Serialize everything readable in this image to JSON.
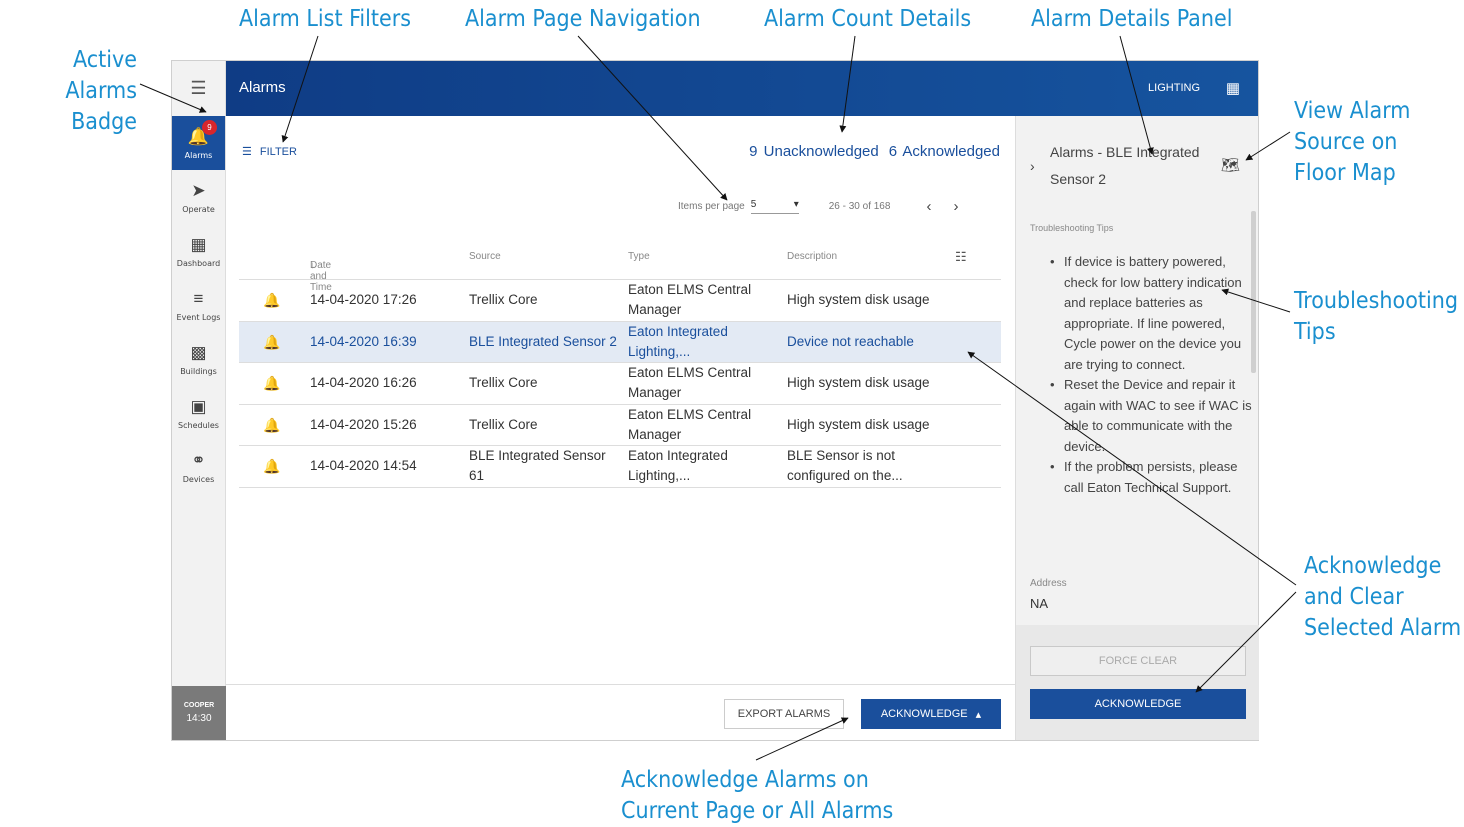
{
  "callouts": {
    "active_alarms_badge": [
      "Active Alarms",
      "Badge"
    ],
    "alarm_list_filters": "Alarm List Filters",
    "alarm_page_navigation": "Alarm Page Navigation",
    "alarm_count_details": "Alarm Count Details",
    "alarm_details_panel": "Alarm Details Panel",
    "view_alarm_source": [
      "View Alarm",
      "Source on",
      "Floor Map"
    ],
    "troubleshooting_tips": [
      "Troubleshooting",
      "Tips"
    ],
    "acknowledge_and_clear": [
      "Acknowledge",
      "and Clear",
      "Selected Alarm"
    ],
    "acknowledge_alarms_on": [
      "Acknowledge Alarms on",
      "Current Page or All Alarms"
    ]
  },
  "rail": {
    "menu_icon": "hamburger-icon",
    "items": [
      {
        "label": "Alarms",
        "icon": "bell-icon",
        "active": true,
        "badge": "9"
      },
      {
        "label": "Operate",
        "icon": "send-icon",
        "active": false
      },
      {
        "label": "Dashboard",
        "icon": "dashboard-icon",
        "active": false
      },
      {
        "label": "Event Logs",
        "icon": "list-icon",
        "active": false
      },
      {
        "label": "Buildings",
        "icon": "building-icon",
        "active": false
      },
      {
        "label": "Schedules",
        "icon": "calendar-icon",
        "active": false
      },
      {
        "label": "Devices",
        "icon": "bulb-icon",
        "active": false
      }
    ],
    "footer": {
      "brand": "COOPER",
      "time": "14:30"
    }
  },
  "topbar": {
    "title": "Alarms",
    "app_name": "LIGHTING",
    "apps_icon": "grid-icon"
  },
  "filter": {
    "label": "FILTER",
    "icon": "filter-icon"
  },
  "counts": {
    "unack_num": "9",
    "unack_label": "Unacknowledged",
    "ack_num": "6",
    "ack_label": "Acknowledged"
  },
  "pager": {
    "items_label": "Items per page",
    "per_page": "5",
    "range": "26 - 30 of 168"
  },
  "table": {
    "headers": {
      "datetime": "Date and Time",
      "source": "Source",
      "type": "Type",
      "description": "Description"
    },
    "rows": [
      {
        "datetime": "14-04-2020 17:26",
        "source": "Trellix Core",
        "type": "Eaton ELMS Central Manager",
        "description": "High system disk usage",
        "selected": false
      },
      {
        "datetime": "14-04-2020 16:39",
        "source": "BLE Integrated Sensor 2",
        "type": "Eaton Integrated Lighting,...",
        "description": "Device not reachable",
        "selected": true
      },
      {
        "datetime": "14-04-2020 16:26",
        "source": "Trellix Core",
        "type": "Eaton ELMS Central Manager",
        "description": "High system disk usage",
        "selected": false
      },
      {
        "datetime": "14-04-2020 15:26",
        "source": "Trellix Core",
        "type": "Eaton ELMS Central Manager",
        "description": "High system disk usage",
        "selected": false
      },
      {
        "datetime": "14-04-2020 14:54",
        "source": "BLE Integrated Sensor 61",
        "type": "Eaton Integrated Lighting,...",
        "description": "BLE Sensor is not configured on the...",
        "selected": false
      }
    ]
  },
  "bottombar": {
    "export_label": "EXPORT ALARMS",
    "ack_label": "ACKNOWLEDGE"
  },
  "panel": {
    "title": "Alarms - BLE Integrated Sensor 2",
    "tips_label": "Troubleshooting Tips",
    "tips": [
      "If device is battery powered, check for low battery indication and replace batteries as appropriate. If line powered, Cycle power on the device you are trying to connect.",
      "Reset the Device and repair it again with WAC to see if WAC is able to communicate with the device.",
      "If the problem persists, please call Eaton Technical Support."
    ],
    "address_label": "Address",
    "address": "NA",
    "force_clear_label": "FORCE CLEAR",
    "ack_label": "ACKNOWLEDGE"
  },
  "colors": {
    "primary": "#1a4f9c",
    "callout": "#1a8fcf",
    "badge": "#d8262c"
  }
}
